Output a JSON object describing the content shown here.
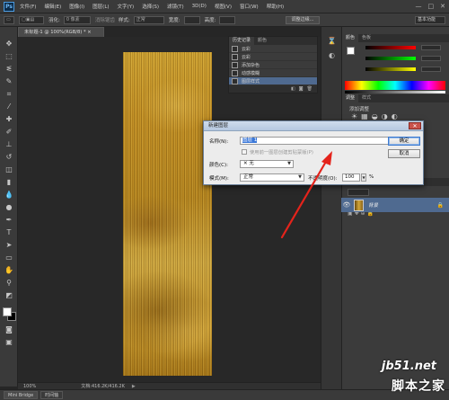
{
  "app": {
    "logo": "Ps",
    "menu": [
      "文件(F)",
      "编辑(E)",
      "图像(I)",
      "图层(L)",
      "文字(Y)",
      "选择(S)",
      "滤镜(T)",
      "3D(D)",
      "视图(V)",
      "窗口(W)",
      "帮助(H)"
    ],
    "window_controls": [
      "—",
      "□",
      "✕"
    ]
  },
  "options_bar": {
    "feather_label": "羽化:",
    "feather_value": "0 像素",
    "antialias_label": "消除锯齿",
    "style_label": "样式:",
    "style_value": "正常",
    "width_label": "宽度:",
    "height_label": "高度:",
    "refine_button": "调整边缘...",
    "workspace": "基本功能"
  },
  "document": {
    "tab_title": "未标题-1 @ 100%(RGB/8) * ×"
  },
  "history_panel": {
    "tabs": [
      "历史记录",
      "颜色"
    ],
    "items": [
      "云彩",
      "云彩",
      "添加杂色",
      "动感模糊",
      "图层样式"
    ],
    "selected_index": 4,
    "footer_icons": [
      "◧",
      "◙",
      "🗑"
    ]
  },
  "right_dock": {
    "color_tabs": [
      "颜色",
      "色板"
    ],
    "adjust_tabs": [
      "调整",
      "样式"
    ],
    "adjust_label": "添加调整",
    "layers_tabs": [
      "图层",
      "通道",
      "路径"
    ],
    "layer_name": "背景",
    "layer_lock": "🔒",
    "colors": {
      "r": "#d84a4a",
      "g": "#4ad84a",
      "b": "#4a4ad8",
      "highlight": "#4f6a90"
    }
  },
  "dialog": {
    "title": "新建图层",
    "close": "✕",
    "name_label": "名称(N):",
    "name_value": "图层 1",
    "clip_checkbox_label": "使用前一图层创建剪贴蒙版(P)",
    "color_label": "颜色(C):",
    "color_value": "✕ 无",
    "mode_label": "模式(M):",
    "mode_value": "正常",
    "opacity_label": "不透明度(O):",
    "opacity_value": "100",
    "opacity_unit": "%",
    "ok_button": "确定",
    "cancel_button": "取消"
  },
  "status": {
    "zoom": "100%",
    "doc_size": "文档:416.2K/416.2K"
  },
  "bottom_tabs": [
    "Mini Bridge",
    "时间轴"
  ],
  "watermark": {
    "site": "jb51.net",
    "name": "脚本之家"
  }
}
